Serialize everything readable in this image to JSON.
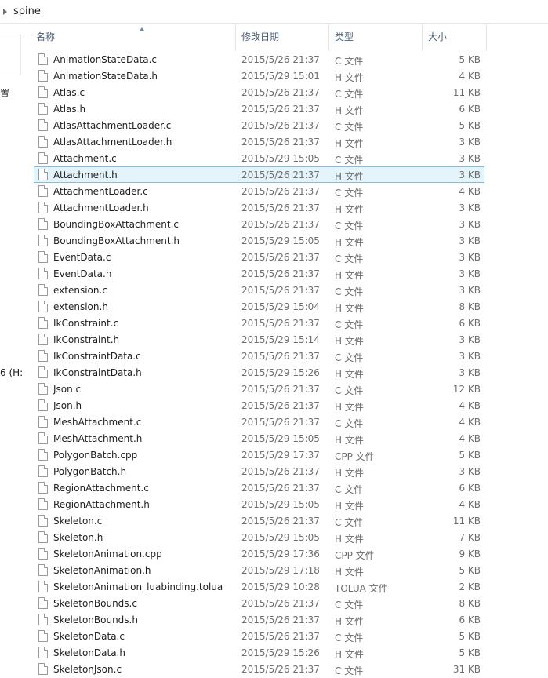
{
  "breadcrumb": {
    "current": "spine"
  },
  "nav": {
    "fragment1": "置",
    "fragment2": "6 (H:"
  },
  "columns": {
    "name": "名称",
    "date": "修改日期",
    "type": "类型",
    "size": "大小"
  },
  "selected_index": 7,
  "files": [
    {
      "name": "AnimationStateData.c",
      "date": "2015/5/26 21:37",
      "type": "C 文件",
      "size": "5 KB"
    },
    {
      "name": "AnimationStateData.h",
      "date": "2015/5/29 15:01",
      "type": "H 文件",
      "size": "4 KB"
    },
    {
      "name": "Atlas.c",
      "date": "2015/5/26 21:37",
      "type": "C 文件",
      "size": "11 KB"
    },
    {
      "name": "Atlas.h",
      "date": "2015/5/26 21:37",
      "type": "H 文件",
      "size": "6 KB"
    },
    {
      "name": "AtlasAttachmentLoader.c",
      "date": "2015/5/26 21:37",
      "type": "C 文件",
      "size": "5 KB"
    },
    {
      "name": "AtlasAttachmentLoader.h",
      "date": "2015/5/26 21:37",
      "type": "H 文件",
      "size": "3 KB"
    },
    {
      "name": "Attachment.c",
      "date": "2015/5/29 15:05",
      "type": "C 文件",
      "size": "3 KB"
    },
    {
      "name": "Attachment.h",
      "date": "2015/5/26 21:37",
      "type": "H 文件",
      "size": "3 KB"
    },
    {
      "name": "AttachmentLoader.c",
      "date": "2015/5/26 21:37",
      "type": "C 文件",
      "size": "4 KB"
    },
    {
      "name": "AttachmentLoader.h",
      "date": "2015/5/26 21:37",
      "type": "H 文件",
      "size": "3 KB"
    },
    {
      "name": "BoundingBoxAttachment.c",
      "date": "2015/5/26 21:37",
      "type": "C 文件",
      "size": "3 KB"
    },
    {
      "name": "BoundingBoxAttachment.h",
      "date": "2015/5/29 15:05",
      "type": "H 文件",
      "size": "3 KB"
    },
    {
      "name": "EventData.c",
      "date": "2015/5/26 21:37",
      "type": "C 文件",
      "size": "3 KB"
    },
    {
      "name": "EventData.h",
      "date": "2015/5/26 21:37",
      "type": "H 文件",
      "size": "3 KB"
    },
    {
      "name": "extension.c",
      "date": "2015/5/26 21:37",
      "type": "C 文件",
      "size": "3 KB"
    },
    {
      "name": "extension.h",
      "date": "2015/5/29 15:04",
      "type": "H 文件",
      "size": "8 KB"
    },
    {
      "name": "IkConstraint.c",
      "date": "2015/5/26 21:37",
      "type": "C 文件",
      "size": "6 KB"
    },
    {
      "name": "IkConstraint.h",
      "date": "2015/5/29 15:14",
      "type": "H 文件",
      "size": "3 KB"
    },
    {
      "name": "IkConstraintData.c",
      "date": "2015/5/26 21:37",
      "type": "C 文件",
      "size": "3 KB"
    },
    {
      "name": "IkConstraintData.h",
      "date": "2015/5/29 15:26",
      "type": "H 文件",
      "size": "3 KB"
    },
    {
      "name": "Json.c",
      "date": "2015/5/26 21:37",
      "type": "C 文件",
      "size": "12 KB"
    },
    {
      "name": "Json.h",
      "date": "2015/5/26 21:37",
      "type": "H 文件",
      "size": "4 KB"
    },
    {
      "name": "MeshAttachment.c",
      "date": "2015/5/26 21:37",
      "type": "C 文件",
      "size": "4 KB"
    },
    {
      "name": "MeshAttachment.h",
      "date": "2015/5/29 15:05",
      "type": "H 文件",
      "size": "4 KB"
    },
    {
      "name": "PolygonBatch.cpp",
      "date": "2015/5/29 17:37",
      "type": "CPP 文件",
      "size": "5 KB"
    },
    {
      "name": "PolygonBatch.h",
      "date": "2015/5/26 21:37",
      "type": "H 文件",
      "size": "3 KB"
    },
    {
      "name": "RegionAttachment.c",
      "date": "2015/5/26 21:37",
      "type": "C 文件",
      "size": "6 KB"
    },
    {
      "name": "RegionAttachment.h",
      "date": "2015/5/29 15:05",
      "type": "H 文件",
      "size": "4 KB"
    },
    {
      "name": "Skeleton.c",
      "date": "2015/5/26 21:37",
      "type": "C 文件",
      "size": "11 KB"
    },
    {
      "name": "Skeleton.h",
      "date": "2015/5/29 15:05",
      "type": "H 文件",
      "size": "7 KB"
    },
    {
      "name": "SkeletonAnimation.cpp",
      "date": "2015/5/29 17:36",
      "type": "CPP 文件",
      "size": "9 KB"
    },
    {
      "name": "SkeletonAnimation.h",
      "date": "2015/5/29 17:18",
      "type": "H 文件",
      "size": "5 KB"
    },
    {
      "name": "SkeletonAnimation_luabinding.tolua",
      "date": "2015/5/29 10:28",
      "type": "TOLUA 文件",
      "size": "2 KB"
    },
    {
      "name": "SkeletonBounds.c",
      "date": "2015/5/26 21:37",
      "type": "C 文件",
      "size": "8 KB"
    },
    {
      "name": "SkeletonBounds.h",
      "date": "2015/5/26 21:37",
      "type": "H 文件",
      "size": "6 KB"
    },
    {
      "name": "SkeletonData.c",
      "date": "2015/5/26 21:37",
      "type": "C 文件",
      "size": "5 KB"
    },
    {
      "name": "SkeletonData.h",
      "date": "2015/5/29 15:26",
      "type": "H 文件",
      "size": "5 KB"
    },
    {
      "name": "SkeletonJson.c",
      "date": "2015/5/26 21:37",
      "type": "C 文件",
      "size": "31 KB"
    }
  ]
}
